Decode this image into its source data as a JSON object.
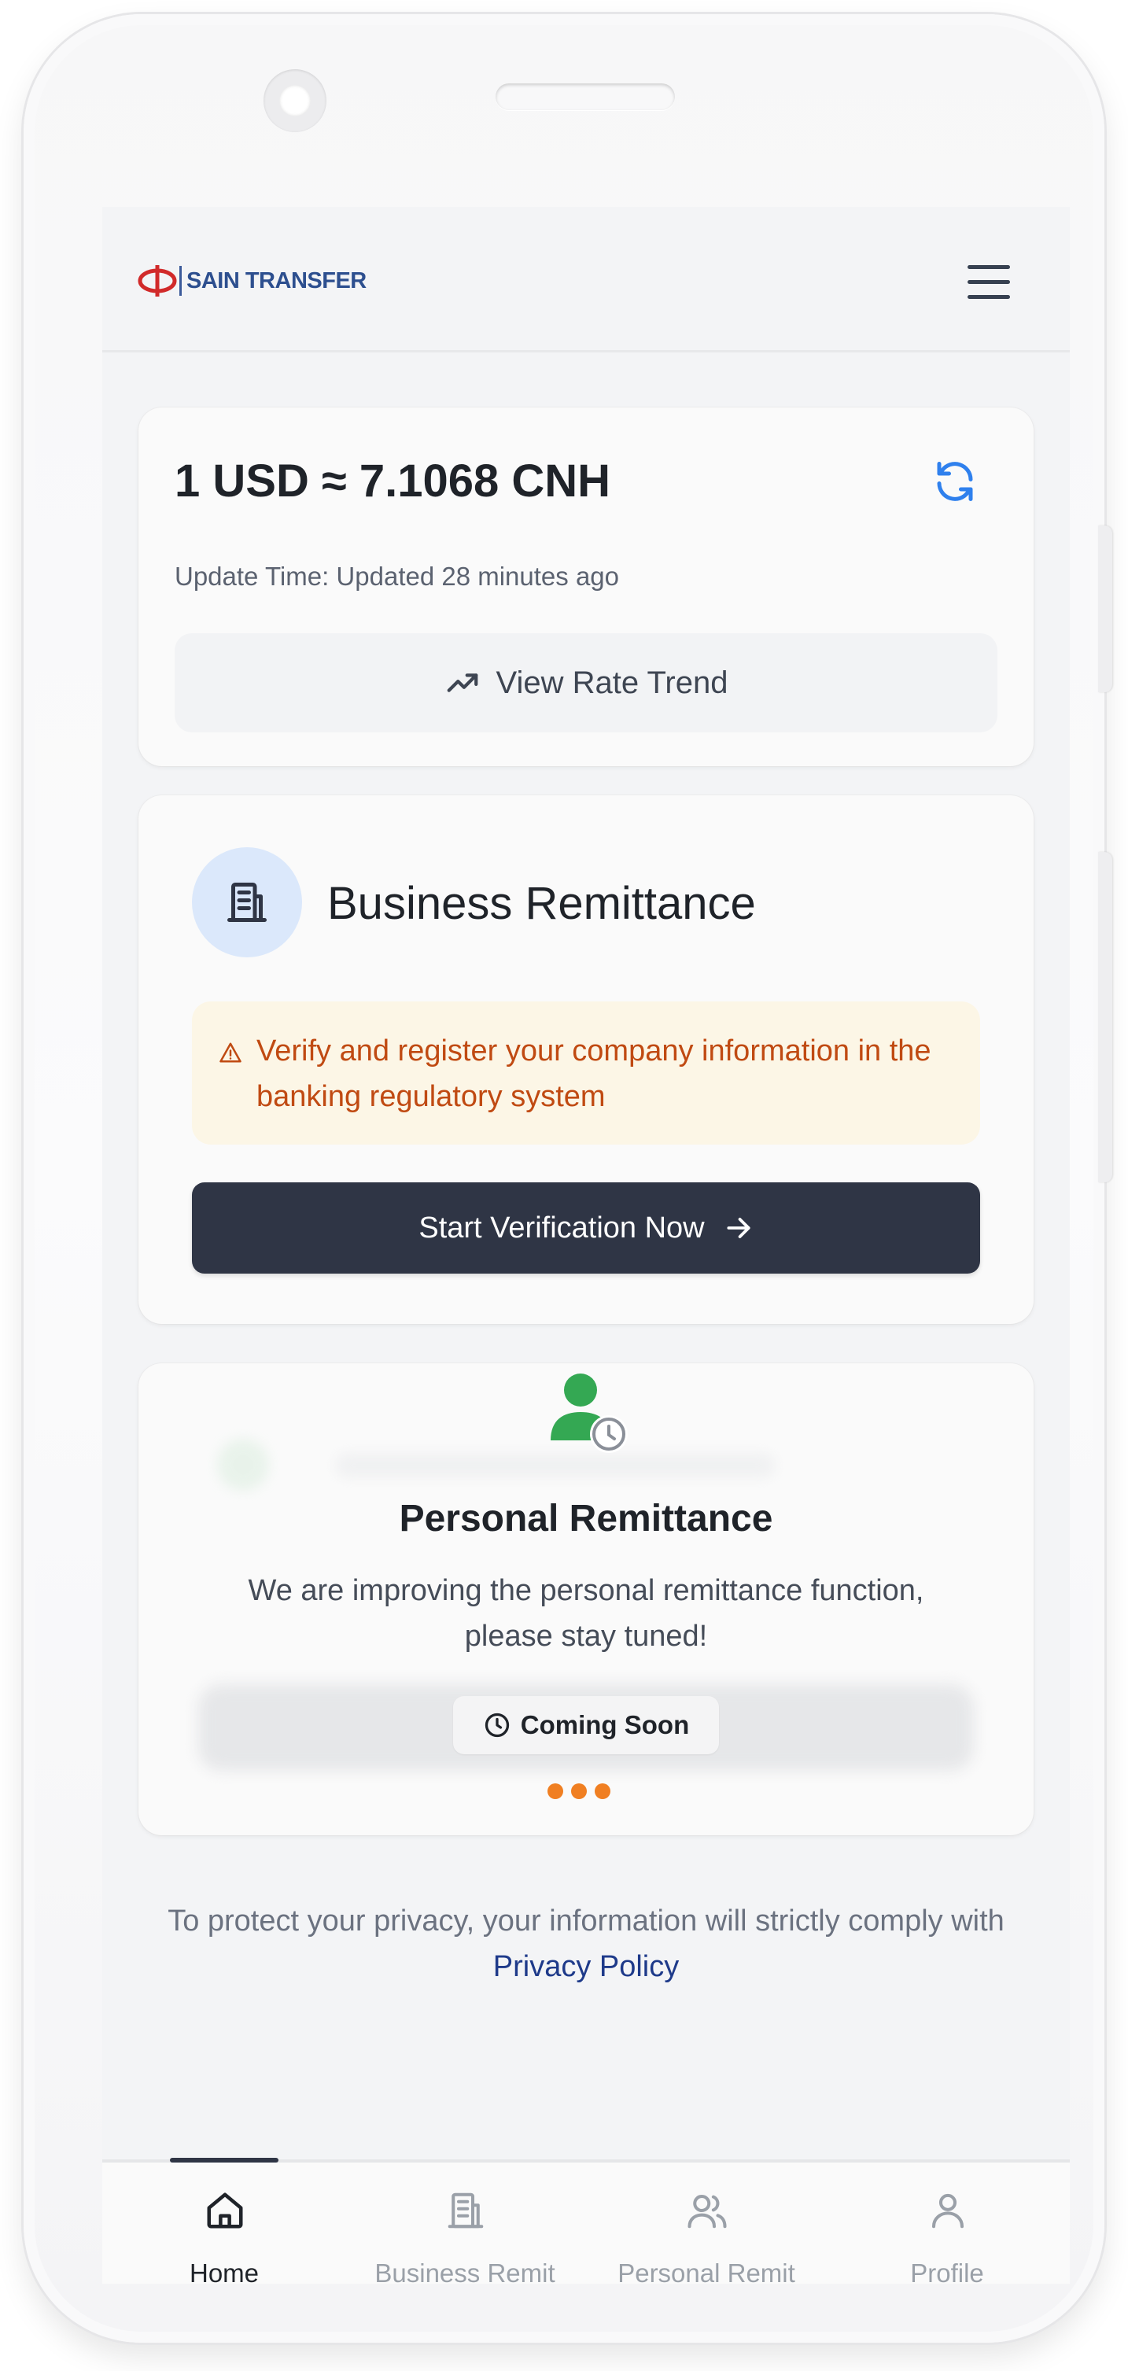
{
  "header": {
    "logo_text": "SAIN TRANSFER",
    "logo_icon": "sain-logo-icon",
    "menu_icon": "hamburger-menu-icon"
  },
  "rate_card": {
    "rate": "1 USD ≈ 7.1068 CNH",
    "update_time": "Update Time: Updated 28 minutes ago",
    "trend_button_label": "View Rate Trend",
    "refresh_icon": "refresh-icon",
    "trend_icon": "trending-up-icon"
  },
  "business_card": {
    "title": "Business Remittance",
    "icon": "building-icon",
    "warning_text": "Verify and register your company information in the banking regulatory system",
    "warning_icon": "warning-triangle-icon",
    "verify_button_label": "Start Verification Now",
    "verify_button_icon": "arrow-right-icon"
  },
  "personal_card": {
    "title": "Personal Remittance",
    "description": "We are improving the personal remittance function, please stay tuned!",
    "badge_label": "Coming Soon",
    "badge_icon": "clock-icon",
    "icon": "user-clock-icon"
  },
  "privacy": {
    "text": "To protect your privacy, your information will strictly comply with ",
    "link_label": "Privacy Policy"
  },
  "bottom_nav": {
    "items": [
      {
        "label": "Home",
        "icon": "home-icon",
        "active": true
      },
      {
        "label": "Business Remit",
        "icon": "building-icon",
        "active": false
      },
      {
        "label": "Personal Remit",
        "icon": "users-icon",
        "active": false
      },
      {
        "label": "Profile",
        "icon": "user-icon",
        "active": false
      }
    ]
  },
  "colors": {
    "primary_dark": "#2f3545",
    "accent_blue": "#2f80ed",
    "warning_text": "#c04a12",
    "warning_bg": "#fcf6e6",
    "success_green": "#34a853",
    "loading_orange": "#f07f22",
    "link_blue": "#1e3a8a"
  }
}
